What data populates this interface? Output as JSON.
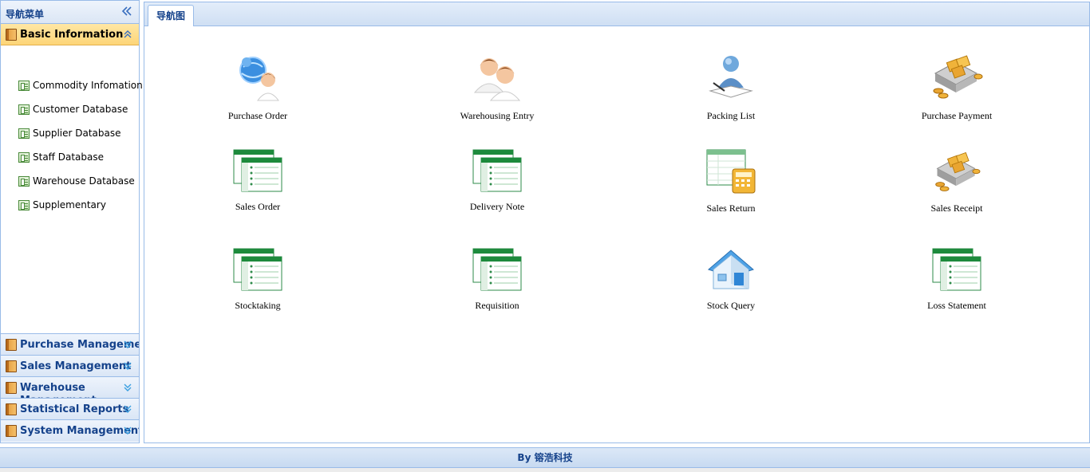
{
  "sidebar": {
    "title": "导航菜单",
    "active_panel": {
      "label": "Basic Information"
    },
    "items": [
      {
        "label": "Commodity Infomation"
      },
      {
        "label": "Customer Database"
      },
      {
        "label": "Supplier Database"
      },
      {
        "label": "Staff Database"
      },
      {
        "label": "Warehouse Database"
      },
      {
        "label": "Supplementary"
      }
    ],
    "panels": [
      {
        "label": "Purchase Management"
      },
      {
        "label": "Sales Management"
      },
      {
        "label": "Warehouse Management"
      },
      {
        "label": "Statistical Reports"
      },
      {
        "label": "System Management"
      }
    ]
  },
  "main": {
    "tab_label": "导航图",
    "tiles": [
      {
        "label": "Purchase Order",
        "icon": "users-globe-icon"
      },
      {
        "label": "Warehousing Entry",
        "icon": "two-users-icon"
      },
      {
        "label": "Packing List",
        "icon": "user-writing-icon"
      },
      {
        "label": "Purchase Payment",
        "icon": "boxes-coins-icon"
      },
      {
        "label": "Sales Order",
        "icon": "spreadsheet-icon"
      },
      {
        "label": "Delivery Note",
        "icon": "spreadsheet-icon"
      },
      {
        "label": "Sales Return",
        "icon": "calculator-sheet-icon"
      },
      {
        "label": "Sales Receipt",
        "icon": "boxes-coins-icon"
      },
      {
        "label": "Stocktaking",
        "icon": "spreadsheet-icon"
      },
      {
        "label": "Requisition",
        "icon": "spreadsheet-icon"
      },
      {
        "label": "Stock Query",
        "icon": "house-icon"
      },
      {
        "label": "Loss Statement",
        "icon": "spreadsheet-icon"
      }
    ]
  },
  "footer": {
    "text": "By 镕浩科技"
  },
  "colors": {
    "accent": "#15428b",
    "border": "#99bbe8",
    "active_panel": "#fdd578"
  }
}
